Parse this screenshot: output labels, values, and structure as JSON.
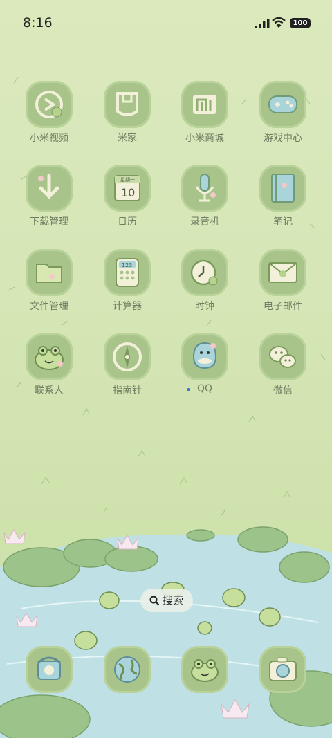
{
  "status_bar": {
    "time": "8:16",
    "battery": "100"
  },
  "apps": [
    {
      "label": "小米视频",
      "icon": "video-play-icon"
    },
    {
      "label": "米家",
      "icon": "mijia-icon"
    },
    {
      "label": "小米商城",
      "icon": "mi-store-icon"
    },
    {
      "label": "游戏中心",
      "icon": "gamepad-icon"
    },
    {
      "label": "下载管理",
      "icon": "download-arrow-icon"
    },
    {
      "label": "日历",
      "icon": "calendar-icon",
      "calendar_header": "星期一",
      "calendar_day": "10"
    },
    {
      "label": "录音机",
      "icon": "microphone-icon"
    },
    {
      "label": "笔记",
      "icon": "notebook-icon"
    },
    {
      "label": "文件管理",
      "icon": "folder-icon"
    },
    {
      "label": "计算器",
      "icon": "calculator-icon",
      "calc_digits": "123"
    },
    {
      "label": "时钟",
      "icon": "clock-icon"
    },
    {
      "label": "电子邮件",
      "icon": "envelope-icon"
    },
    {
      "label": "联系人",
      "icon": "frog-contact-icon"
    },
    {
      "label": "指南针",
      "icon": "compass-icon"
    },
    {
      "label": "QQ",
      "icon": "qq-penguin-icon",
      "new_indicator": true
    },
    {
      "label": "微信",
      "icon": "wechat-icon"
    }
  ],
  "search": {
    "label": "搜索",
    "icon": "search-icon"
  },
  "dock": [
    {
      "icon": "telephone-icon"
    },
    {
      "icon": "globe-browser-icon"
    },
    {
      "icon": "frog-messages-icon"
    },
    {
      "icon": "camera-icon"
    }
  ],
  "colors": {
    "icon_bg": "#a9c48a",
    "label": "#6f7e62",
    "wallpaper": "#d6e6b6",
    "pond": "#bfe1e6"
  }
}
